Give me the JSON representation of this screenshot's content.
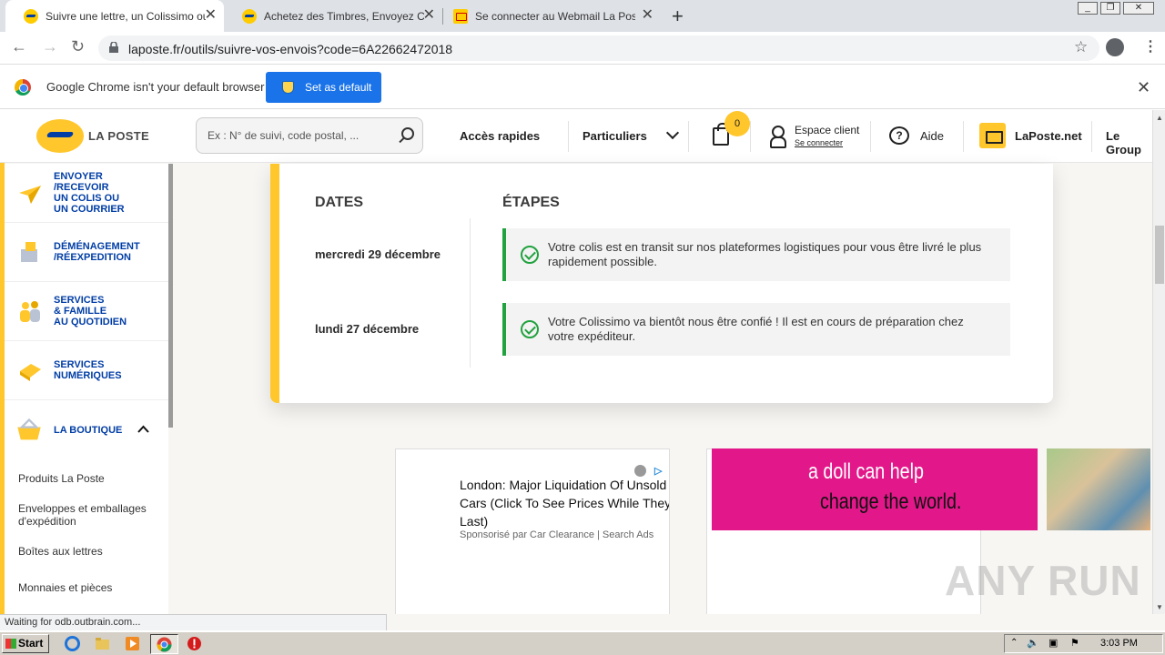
{
  "browser": {
    "tabs": [
      {
        "title": "Suivre une lettre, un Colissimo ou un",
        "active": true
      },
      {
        "title": "Achetez des Timbres, Envoyez Cour",
        "active": false
      },
      {
        "title": "Se connecter au Webmail La Poste –",
        "active": false
      }
    ],
    "url": "laposte.fr/outils/suivre-vos-envois?code=6A22662472018",
    "infobar_text": "Google Chrome isn't your default browser",
    "infobar_button": "Set as default"
  },
  "site": {
    "logo_text": "LA POSTE",
    "search_placeholder": "Ex : N° de suivi, code postal, ...",
    "nav": {
      "acces_rapides": "Accès rapides",
      "particuliers": "Particuliers",
      "cart_count": "0",
      "espace_client": "Espace client",
      "se_connecter": "Se connecter",
      "aide": "Aide",
      "laposte_net": "LaPoste.net",
      "le_groupe": "Le Group"
    },
    "sidebar": [
      {
        "label": "ENVOYER\n/RECEVOIR\nUN COLIS OU\nUN COURRIER",
        "icon": "paper-plane-icon"
      },
      {
        "label": "DÉMÉNAGEMENT\n/RÉEXPEDITION",
        "icon": "moving-box-icon"
      },
      {
        "label": "SERVICES\n& FAMILLE\nAU QUOTIDIEN",
        "icon": "family-icon"
      },
      {
        "label": "SERVICES\nNUMÉRIQUES",
        "icon": "digital-services-icon"
      },
      {
        "label": "LA BOUTIQUE",
        "icon": "shop-basket-icon"
      }
    ],
    "boutique_items": [
      "Produits La Poste",
      "Enveloppes et emballages\nd'expédition",
      "Boîtes aux lettres",
      "Monnaies et pièces"
    ]
  },
  "tracking": {
    "dates_header": "DATES",
    "steps_header": "ÉTAPES",
    "events": [
      {
        "date": "mercredi 29 décembre",
        "text": "Votre colis est en transit sur nos plateformes logistiques pour vous être livré le plus rapidement possible."
      },
      {
        "date": "lundi 27 décembre",
        "text": "Votre Colissimo va bientôt nous être confié ! Il est en cours de préparation chez votre expéditeur."
      }
    ]
  },
  "ads": {
    "ad1_title": "London: Major Liquidation Of Unsold Cars (Click To See Prices While They Last)",
    "ad1_sponsor": "Sponsorisé par Car Clearance | Search Ads",
    "banner_line1": "a doll can help",
    "banner_line2": "change the world.",
    "watermark": "ANY RUN"
  },
  "status_text": "Waiting for odb.outbrain.com...",
  "taskbar": {
    "start": "Start",
    "clock": "3:03 PM"
  }
}
